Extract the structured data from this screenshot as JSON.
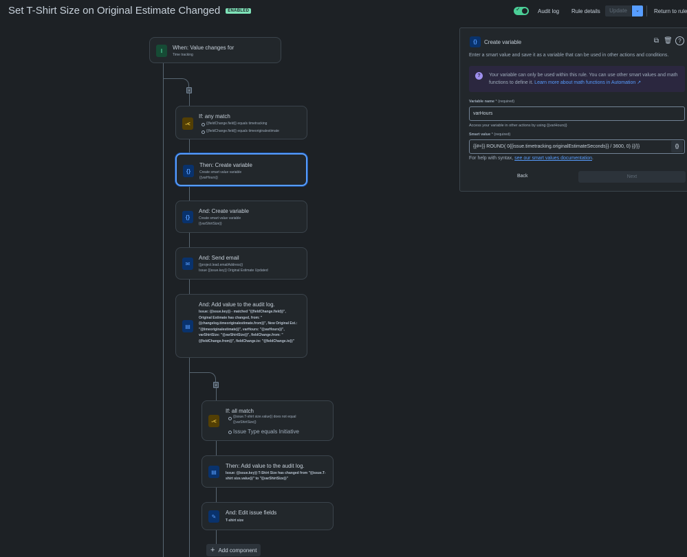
{
  "header": {
    "title": "Set T-Shirt Size on Original Estimate Changed",
    "status_badge": "ENABLED",
    "toggle_check": "✓",
    "audit_log": "Audit log",
    "rule_details": "Rule details",
    "update": "Update",
    "update_dropdown": "⌄",
    "return": "Return to rules"
  },
  "flow": {
    "if_chip": "if",
    "trigger": {
      "title": "When: Value changes for",
      "subtitle": "Time tracking",
      "icon": "value-change-icon"
    },
    "condition1": {
      "title": "If: any match",
      "items": [
        "{{fieldChange.field}} equals timetracking",
        "{{fieldChange.field}} equals timeoriginalestimate"
      ],
      "icon": "branch-condition-icon"
    },
    "action1": {
      "title": "Then: Create variable",
      "line1": "Create smart value variable",
      "line2": "{{varHours}}",
      "icon": "curly-braces-icon"
    },
    "action2": {
      "title": "And: Create variable",
      "line1": "Create smart value variable",
      "line2": "{{varShirtSize}}",
      "icon": "curly-braces-icon"
    },
    "action3": {
      "title": "And: Send email",
      "line1": "{{project.lead.emailAddress}}",
      "line2": "Issue {{issue.key}} Original Estimate Updated",
      "icon": "email-icon"
    },
    "action4": {
      "title": "And: Add value to the audit log.",
      "body": "Issue: {{issue.key}} - matched \"{{fieldChange.field}}\", Original Estimate has changed, from: \"{{changelog.timeoriginalestimate.from}}\", New Original Est.: \"{{timeoriginalestimate}}\", varHours: \"{{varHours}}\", varShirtSize: \"{{varShirtSize}}\", fieldChange.from: \"{{fieldChange.from}}\", fieldChange.to: \"{{fieldChange.to}}\"",
      "icon": "audit-log-icon"
    },
    "condition2": {
      "title": "If: all match",
      "item1": "{{issue.T-shirt size.value}} does not equal {{varShirtSize}}",
      "item2": "Issue Type equals Initiative",
      "icon": "branch-condition-icon"
    },
    "action5": {
      "title": "Then: Add value to the audit log.",
      "body": "Issue: {{issue.key}} T-Shirt Size has changed from \"{{issue.T-shirt size.value}}\" to \"{{varShirtSize}}\"",
      "icon": "audit-log-icon"
    },
    "action6": {
      "title": "And: Edit issue fields",
      "body": "T-shirt size",
      "icon": "pencil-icon"
    },
    "add_component": "Add component"
  },
  "panel": {
    "title": "Create variable",
    "description": "Enter a smart value and save it as a variable that can be used in other actions and conditions.",
    "info_text": "Your variable can only be used within this rule. You can use other smart values and math functions to define it.",
    "info_link": "Learn more about math functions in Automation ↗",
    "variable_name_label": "Variable name",
    "variable_name_required": "* (required)",
    "variable_name_value": "varHours",
    "variable_name_help": "Access your variable in other actions by using {{varHours}}",
    "smart_value_label": "Smart value",
    "smart_value_required": "* (required)",
    "smart_value_value": "{{#=}} ROUND( 0{{issue.timetracking.originalEstimateSeconds}} / 3600, 0) {{/}}",
    "syntax_text": "For help with syntax,",
    "syntax_link": "see our smart values documentation",
    "syntax_end": ".",
    "back": "Back",
    "next": "Next"
  },
  "colors": {
    "accent": "#579dff",
    "enabled": "#4bce97",
    "background": "#1d2125",
    "card": "#22272b"
  }
}
